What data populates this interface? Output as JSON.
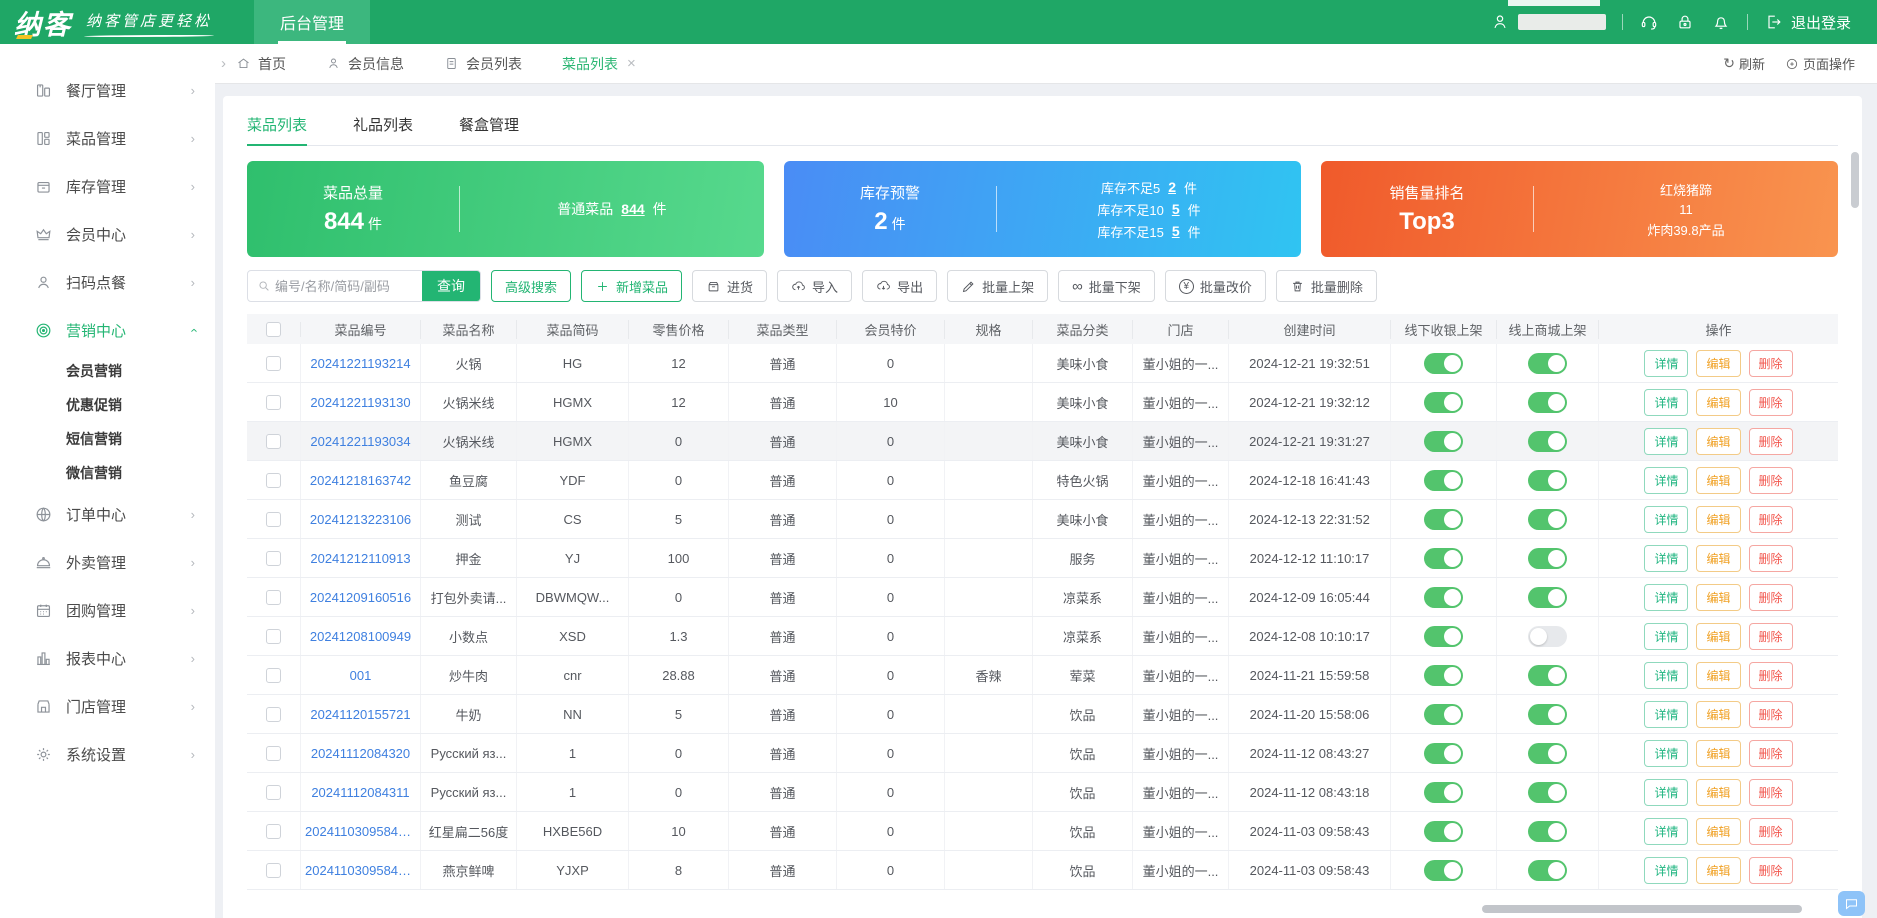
{
  "colors": {
    "brand_green": "#1fa766",
    "accent_green": "#23b573",
    "link_blue": "#3f80e0",
    "edit_yellow": "#f0a125",
    "delete_red": "#f2564d",
    "card_green": [
      "#2fbf6d",
      "#57d98d"
    ],
    "card_blue": [
      "#4a8cf5",
      "#30c4f2"
    ],
    "card_orange": [
      "#f05a2b",
      "#f9944f"
    ]
  },
  "header": {
    "logo_text": "纳客",
    "slogan": "纳客管店更轻松",
    "nav_tab": "后台管理",
    "logout_label": "退出登录",
    "icons": [
      "user-icon",
      "headset-icon",
      "lock-icon",
      "bell-icon",
      "exit-icon"
    ]
  },
  "tabbar": {
    "tabs": [
      {
        "label": "首页",
        "icon": "home",
        "active": false,
        "closable": false
      },
      {
        "label": "会员信息",
        "icon": "user",
        "active": false,
        "closable": false
      },
      {
        "label": "会员列表",
        "icon": "doc",
        "active": false,
        "closable": false
      },
      {
        "label": "菜品列表",
        "icon": "",
        "active": true,
        "closable": true
      }
    ],
    "refresh_label": "刷新",
    "page_ops_label": "页面操作"
  },
  "sidebar": {
    "items": [
      {
        "label": "餐厅管理",
        "icon": "restaurant",
        "chevron": "right",
        "active": false,
        "children": []
      },
      {
        "label": "菜品管理",
        "icon": "dishes",
        "chevron": "right",
        "active": false,
        "children": []
      },
      {
        "label": "库存管理",
        "icon": "inventory",
        "chevron": "right",
        "active": false,
        "children": []
      },
      {
        "label": "会员中心",
        "icon": "crown",
        "chevron": "right",
        "active": false,
        "children": []
      },
      {
        "label": "扫码点餐",
        "icon": "scan-person",
        "chevron": "right",
        "active": false,
        "children": []
      },
      {
        "label": "营销中心",
        "icon": "target",
        "chevron": "up",
        "active": true,
        "children": [
          "会员营销",
          "优惠促销",
          "短信营销",
          "微信营销"
        ]
      },
      {
        "label": "订单中心",
        "icon": "globe",
        "chevron": "right",
        "active": false,
        "children": []
      },
      {
        "label": "外卖管理",
        "icon": "cloche",
        "chevron": "right",
        "active": false,
        "children": []
      },
      {
        "label": "团购管理",
        "icon": "calendar",
        "chevron": "right",
        "active": false,
        "children": []
      },
      {
        "label": "报表中心",
        "icon": "chart",
        "chevron": "right",
        "active": false,
        "children": []
      },
      {
        "label": "门店管理",
        "icon": "shop",
        "chevron": "right",
        "active": false,
        "children": []
      },
      {
        "label": "系统设置",
        "icon": "gear",
        "chevron": "right",
        "active": false,
        "children": []
      }
    ]
  },
  "panel": {
    "tabs": [
      {
        "label": "菜品列表",
        "active": true
      },
      {
        "label": "礼品列表",
        "active": false
      },
      {
        "label": "餐盒管理",
        "active": false
      }
    ]
  },
  "cards": {
    "dishes": {
      "title": "菜品总量",
      "value": "844",
      "unit": "件",
      "right_label": "普通菜品",
      "right_value": "844",
      "right_unit": "件"
    },
    "stock": {
      "title": "库存预警",
      "value": "2",
      "unit": "件",
      "rows": [
        {
          "label": "库存不足5",
          "value": "2",
          "unit": "件"
        },
        {
          "label": "库存不足10",
          "value": "5",
          "unit": "件"
        },
        {
          "label": "库存不足15",
          "value": "5",
          "unit": "件"
        }
      ]
    },
    "sales": {
      "title": "销售量排名",
      "value": "Top3",
      "lines": [
        "红烧猪蹄",
        "11",
        "炸肉39.8产品"
      ]
    }
  },
  "toolbar": {
    "search_placeholder": "编号/名称/简码/副码",
    "search_button": "查询",
    "buttons": [
      {
        "label": "高级搜索",
        "style": "outline-green",
        "icon": ""
      },
      {
        "label": "新增菜品",
        "style": "outline-green",
        "icon": "plus"
      },
      {
        "label": "进货",
        "style": "default",
        "icon": "box"
      },
      {
        "label": "导入",
        "style": "default",
        "icon": "cloud-up"
      },
      {
        "label": "导出",
        "style": "default",
        "icon": "cloud-down"
      },
      {
        "label": "批量上架",
        "style": "default",
        "icon": "pencil"
      },
      {
        "label": "批量下架",
        "style": "default",
        "icon": "chain"
      },
      {
        "label": "批量改价",
        "style": "default",
        "icon": "yen"
      },
      {
        "label": "批量删除",
        "style": "default",
        "icon": "trash"
      }
    ]
  },
  "table": {
    "columns": [
      "",
      "菜品编号",
      "菜品名称",
      "菜品简码",
      "零售价格",
      "菜品类型",
      "会员特价",
      "规格",
      "菜品分类",
      "门店",
      "创建时间",
      "线下收银上架",
      "线上商城上架",
      "操作"
    ],
    "actions": [
      "详情",
      "编辑",
      "删除"
    ],
    "rows": [
      {
        "id": "20241221193214",
        "name": "火锅",
        "code": "HG",
        "price": "12",
        "type": "普通",
        "vip": "0",
        "spec": "",
        "category": "美味小食",
        "store": "董小姐的一...",
        "created": "2024-12-21 19:32:51",
        "pos": true,
        "mall": true,
        "highlight": false
      },
      {
        "id": "20241221193130",
        "name": "火锅米线",
        "code": "HGMX",
        "price": "12",
        "type": "普通",
        "vip": "10",
        "spec": "",
        "category": "美味小食",
        "store": "董小姐的一...",
        "created": "2024-12-21 19:32:12",
        "pos": true,
        "mall": true,
        "highlight": false
      },
      {
        "id": "20241221193034",
        "name": "火锅米线",
        "code": "HGMX",
        "price": "0",
        "type": "普通",
        "vip": "0",
        "spec": "",
        "category": "美味小食",
        "store": "董小姐的一...",
        "created": "2024-12-21 19:31:27",
        "pos": true,
        "mall": true,
        "highlight": true
      },
      {
        "id": "20241218163742",
        "name": "鱼豆腐",
        "code": "YDF",
        "price": "0",
        "type": "普通",
        "vip": "0",
        "spec": "",
        "category": "特色火锅",
        "store": "董小姐的一...",
        "created": "2024-12-18 16:41:43",
        "pos": true,
        "mall": true,
        "highlight": false
      },
      {
        "id": "20241213223106",
        "name": "测试",
        "code": "CS",
        "price": "5",
        "type": "普通",
        "vip": "0",
        "spec": "",
        "category": "美味小食",
        "store": "董小姐的一...",
        "created": "2024-12-13 22:31:52",
        "pos": true,
        "mall": true,
        "highlight": false
      },
      {
        "id": "20241212110913",
        "name": "押金",
        "code": "YJ",
        "price": "100",
        "type": "普通",
        "vip": "0",
        "spec": "",
        "category": "服务",
        "store": "董小姐的一...",
        "created": "2024-12-12 11:10:17",
        "pos": true,
        "mall": true,
        "highlight": false
      },
      {
        "id": "20241209160516",
        "name": "打包外卖请...",
        "code": "DBWMQW...",
        "price": "0",
        "type": "普通",
        "vip": "0",
        "spec": "",
        "category": "凉菜系",
        "store": "董小姐的一...",
        "created": "2024-12-09 16:05:44",
        "pos": true,
        "mall": true,
        "highlight": false
      },
      {
        "id": "20241208100949",
        "name": "小数点",
        "code": "XSD",
        "price": "1.3",
        "type": "普通",
        "vip": "0",
        "spec": "",
        "category": "凉菜系",
        "store": "董小姐的一...",
        "created": "2024-12-08 10:10:17",
        "pos": true,
        "mall": false,
        "highlight": false
      },
      {
        "id": "001",
        "name": "炒牛肉",
        "code": "cnr",
        "price": "28.88",
        "type": "普通",
        "vip": "0",
        "spec": "香辣",
        "category": "荤菜",
        "store": "董小姐的一...",
        "created": "2024-11-21 15:59:58",
        "pos": true,
        "mall": true,
        "highlight": false
      },
      {
        "id": "20241120155721",
        "name": "牛奶",
        "code": "NN",
        "price": "5",
        "type": "普通",
        "vip": "0",
        "spec": "",
        "category": "饮品",
        "store": "董小姐的一...",
        "created": "2024-11-20 15:58:06",
        "pos": true,
        "mall": true,
        "highlight": false
      },
      {
        "id": "20241112084320",
        "name": "Русский яз...",
        "code": "1",
        "price": "0",
        "type": "普通",
        "vip": "0",
        "spec": "",
        "category": "饮品",
        "store": "董小姐的一...",
        "created": "2024-11-12 08:43:27",
        "pos": true,
        "mall": true,
        "highlight": false
      },
      {
        "id": "20241112084311",
        "name": "Русский яз...",
        "code": "1",
        "price": "0",
        "type": "普通",
        "vip": "0",
        "spec": "",
        "category": "饮品",
        "store": "董小姐的一...",
        "created": "2024-11-12 08:43:18",
        "pos": true,
        "mall": true,
        "highlight": false
      },
      {
        "id": "20241103095843...",
        "name": "红星扁二56度",
        "code": "HXBE56D",
        "price": "10",
        "type": "普通",
        "vip": "0",
        "spec": "",
        "category": "饮品",
        "store": "董小姐的一...",
        "created": "2024-11-03 09:58:43",
        "pos": true,
        "mall": true,
        "highlight": false
      },
      {
        "id": "20241103095843...",
        "name": "燕京鲜啤",
        "code": "YJXP",
        "price": "8",
        "type": "普通",
        "vip": "0",
        "spec": "",
        "category": "饮品",
        "store": "董小姐的一...",
        "created": "2024-11-03 09:58:43",
        "pos": true,
        "mall": true,
        "highlight": false
      }
    ]
  }
}
